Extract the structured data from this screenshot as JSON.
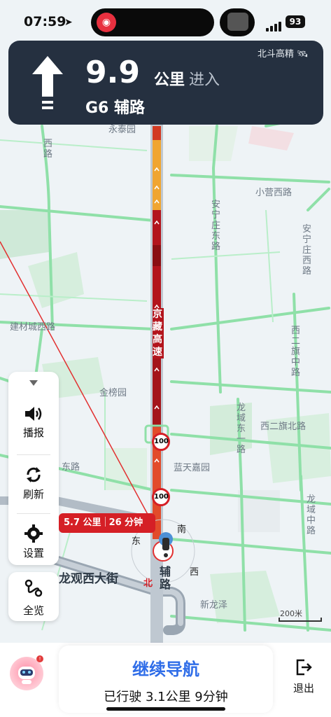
{
  "status_bar": {
    "time": "07:59",
    "battery": "93"
  },
  "navigation": {
    "distance": "9.9",
    "unit": "公里",
    "action": "进入",
    "road": "G6 辅路",
    "positioning": "北斗高精",
    "maneuver_icon": "straight-arrow-icon"
  },
  "map": {
    "labels": {
      "yongtai": "永泰园",
      "xiaoying_west": "小营西路",
      "anning_east": "安宁庄东路",
      "anning_west": "安宁庄西路",
      "jiancai_west": "建材城西路",
      "xi_er_qi_middle": "西二旗中路",
      "jingbang": "金榜园",
      "longyu_east1": "龙域东一路",
      "xi_er_qi_north": "西二旗北路",
      "lantian": "蓝天嘉园",
      "longyu_middle": "龙域中路",
      "xinlongze": "新龙泽",
      "longguan_west": "龙观西大街",
      "dong_road": "东路",
      "road_left_v": "西路"
    },
    "route_name": "京藏高速",
    "aux_road": "辅路",
    "speed_limits": [
      "100",
      "100"
    ],
    "compass": {
      "north": "北",
      "south": "南",
      "east": "东",
      "west": "西"
    },
    "scale": "200米",
    "colors": {
      "congested": "#b3141c",
      "heavy": "#e24b2b",
      "slow": "#f0a531",
      "road_green": "#8fe0a8",
      "panel_dark": "#253040",
      "accent_blue": "#2f6de8"
    }
  },
  "eta_bubble": {
    "distance": "5.7 公里",
    "time": "26 分钟"
  },
  "side_panel": {
    "report": "播报",
    "refresh": "刷新",
    "settings": "设置",
    "overview": "全览"
  },
  "bottom_bar": {
    "continue_label": "继续导航",
    "traveled": "已行驶 3.1公里 9分钟",
    "exit_label": "退出"
  }
}
